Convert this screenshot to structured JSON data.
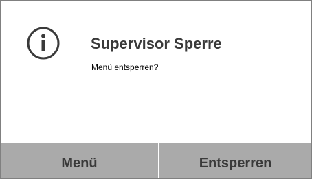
{
  "dialog": {
    "icon": "info-icon",
    "title": "Supervisor Sperre",
    "message": "Menü entsperren?"
  },
  "buttons": {
    "menu_label": "Menü",
    "unlock_label": "Entsperren"
  },
  "colors": {
    "text_dark": "#3a3a3a",
    "button_bg": "#aaaaaa",
    "border": "#808080",
    "background": "#ffffff"
  }
}
